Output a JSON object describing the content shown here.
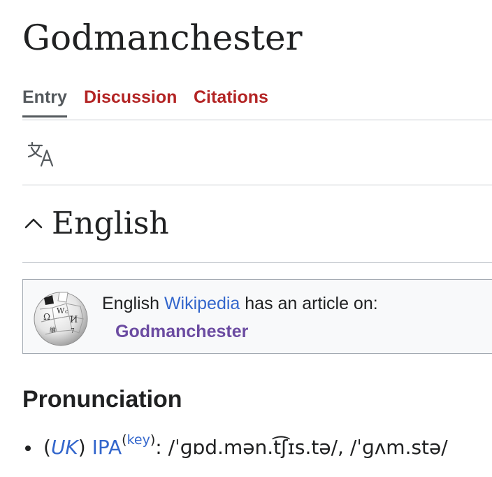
{
  "page": {
    "title": "Godmanchester"
  },
  "tabs": [
    {
      "label": "Entry",
      "active": true
    },
    {
      "label": "Discussion",
      "active": false
    },
    {
      "label": "Citations",
      "active": false
    }
  ],
  "icons": {
    "language": "translate-icon",
    "collapse": "chevron-up-icon",
    "wikipedia": "wikipedia-globe-icon"
  },
  "section": {
    "title": "English"
  },
  "wikipedia_box": {
    "prefix": "English ",
    "wikipedia_link": "Wikipedia",
    "suffix": " has an article on:",
    "article_link": "Godmanchester"
  },
  "pronunciation": {
    "heading": "Pronunciation",
    "open_paren": "(",
    "region": "UK",
    "close_paren": ")",
    "ipa_label": "IPA",
    "key_open": "(",
    "key_label": "key",
    "key_close": ")",
    "transcription": ": /ˈɡɒd.mən.t͡ʃɪs.tə/, /ˈɡʌm.stə/"
  },
  "colors": {
    "link": "#3366cc",
    "visited_link": "#6b4ba1",
    "red_link": "#b32424",
    "active_tab": "#54595d",
    "border": "#c8ccd1"
  }
}
